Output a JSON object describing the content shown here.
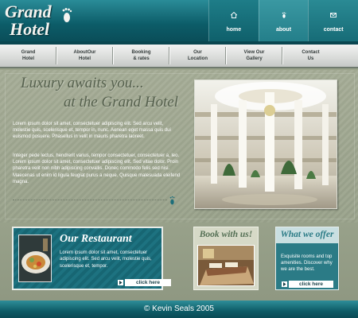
{
  "brand": {
    "logo_line1": "Grand",
    "logo_line2": "Hotel"
  },
  "top_nav": [
    {
      "label": "home",
      "icon": "house-icon"
    },
    {
      "label": "about",
      "icon": "footprint-icon"
    },
    {
      "label": "contact",
      "icon": "envelope-icon"
    }
  ],
  "main_nav": [
    {
      "line1": "Grand",
      "line2": "Hotel"
    },
    {
      "line1": "AboutOur",
      "line2": "Hotel"
    },
    {
      "line1": "Booking",
      "line2": "& rates"
    },
    {
      "line1": "Our",
      "line2": "Location"
    },
    {
      "line1": "View Our",
      "line2": "Gallery"
    },
    {
      "line1": "Contact",
      "line2": "Us"
    }
  ],
  "hero": {
    "tagline_line1": "Luxury awaits you...",
    "tagline_line2": "at the Grand Hotel",
    "paragraph1": "Lorem ipsum dolor sit amet, consectetuer adipiscing elit. Sed arcu velit, molestie quis, scelerisque et, tempor in, nunc. Aenean eget massa quis dui euismod posuere. Phasellus in velit in mauris pharetra laoreet.",
    "paragraph2": "Integer pede lectus, hendrerit varius, tempor consectetuer, consectetuer a, leo. Lorem ipsum dolor sit amet, consectetuer adipiscing elit. Sed vitae dolor. Proin pharetra velit non nibh adipiscing convallis. Donec commodo felis sed nisi. Maecenas ut enim id ligula feugiat purus a neque. Quisque malesuada eleifend magna."
  },
  "restaurant": {
    "title": "Our Restaurant",
    "description": "Lorem ipsum dolor sit amet, consectetuer adipiscing elit. Sed arcu velit, molestie quis, scelerisque et, tempor.",
    "button": "click here"
  },
  "booking": {
    "title": "Book with us!"
  },
  "offer": {
    "title": "What we offer",
    "description": "Exquisite rooms and top amenities.  Discover why we are the best.",
    "button": "click here"
  },
  "footer": {
    "text": "©  Kevin Seals  2005"
  },
  "colors": {
    "teal": "#0c5c68",
    "olive_background": "#9aa38c",
    "tagline": "#56614e"
  }
}
